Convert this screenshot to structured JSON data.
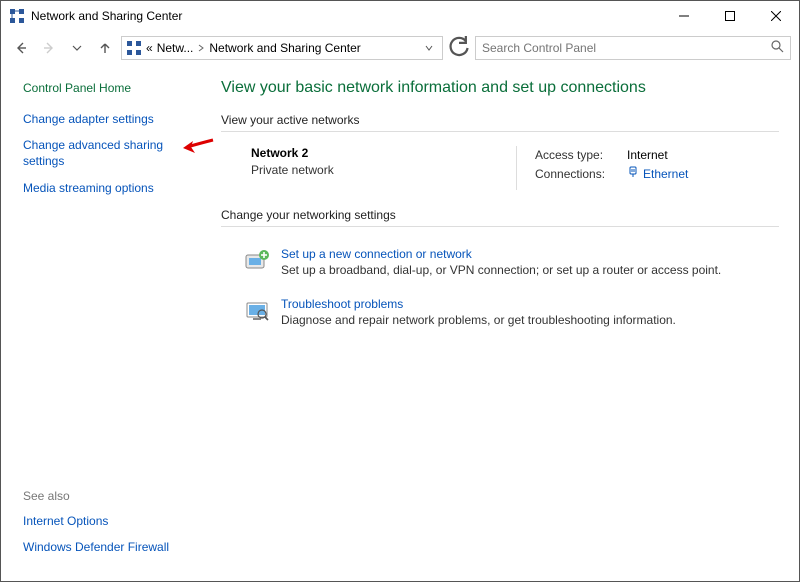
{
  "window": {
    "title": "Network and Sharing Center"
  },
  "breadcrumb": {
    "root_abbrev": "«",
    "item1": "Netw...",
    "item2": "Network and Sharing Center"
  },
  "search": {
    "placeholder": "Search Control Panel"
  },
  "sidebar": {
    "home": "Control Panel Home",
    "links": {
      "adapter": "Change adapter settings",
      "sharing": "Change advanced sharing settings",
      "media": "Media streaming options"
    },
    "seealso_label": "See also",
    "seealso": {
      "inet": "Internet Options",
      "firewall": "Windows Defender Firewall"
    }
  },
  "main": {
    "title": "View your basic network information and set up connections",
    "active_heading": "View your active networks",
    "network": {
      "name": "Network 2",
      "type": "Private network",
      "access_label": "Access type:",
      "access_value": "Internet",
      "conn_label": "Connections:",
      "conn_value": "Ethernet"
    },
    "change_heading": "Change your networking settings",
    "task1": {
      "title": "Set up a new connection or network",
      "desc": "Set up a broadband, dial-up, or VPN connection; or set up a router or access point."
    },
    "task2": {
      "title": "Troubleshoot problems",
      "desc": "Diagnose and repair network problems, or get troubleshooting information."
    }
  }
}
